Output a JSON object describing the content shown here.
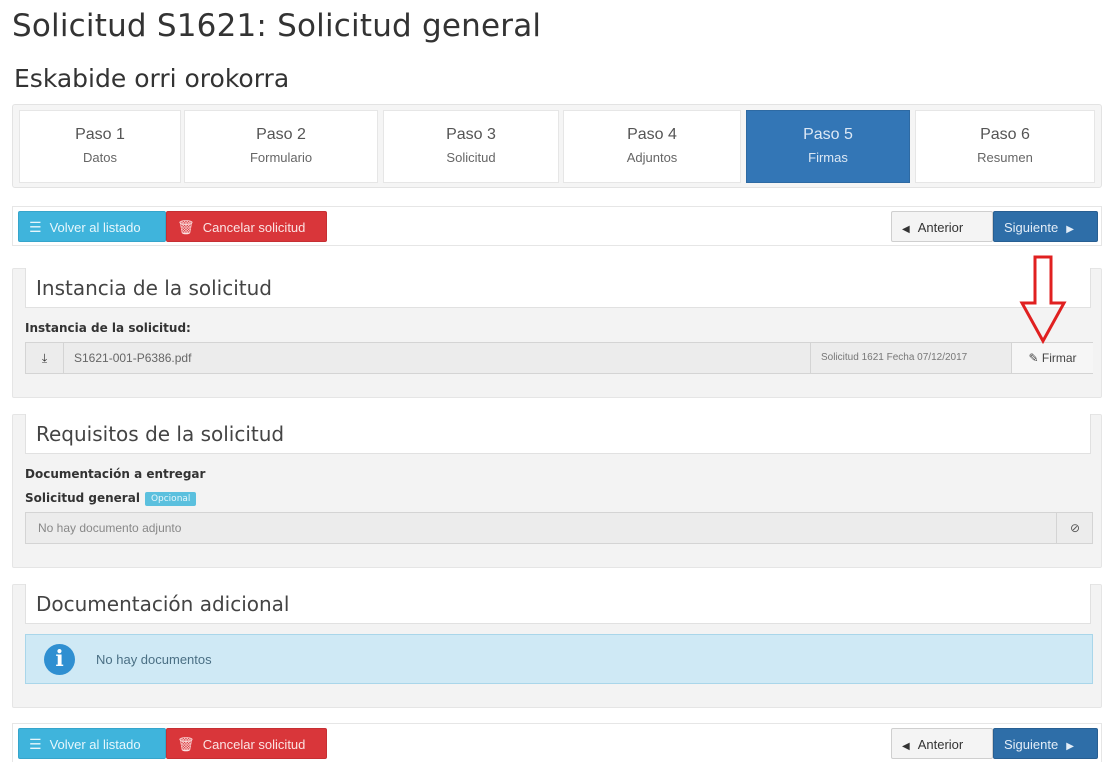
{
  "header": {
    "title": "Solicitud S1621: Solicitud general",
    "subtitle": "Eskabide orri orokorra"
  },
  "steps": [
    {
      "num": "Paso 1",
      "label": "Datos"
    },
    {
      "num": "Paso 2",
      "label": "Formulario"
    },
    {
      "num": "Paso 3",
      "label": "Solicitud"
    },
    {
      "num": "Paso 4",
      "label": "Adjuntos"
    },
    {
      "num": "Paso 5",
      "label": "Firmas"
    },
    {
      "num": "Paso 6",
      "label": "Resumen"
    }
  ],
  "toolbar": {
    "back_label": "Volver al listado",
    "cancel_label": "Cancelar solicitud",
    "prev_label": "Anterior",
    "next_label": "Siguiente"
  },
  "instancia": {
    "heading": "Instancia de la solicitud",
    "field_label": "Instancia de la solicitud:",
    "file_name": "S1621-001-P6386.pdf",
    "file_meta": "Solicitud 1621 Fecha 07/12/2017",
    "sign_label": "Firmar"
  },
  "requisitos": {
    "heading": "Requisitos de la solicitud",
    "doc_label": "Documentación a entregar",
    "item_label": "Solicitud general",
    "item_badge": "Opcional",
    "empty_text": "No hay documento adjunto"
  },
  "adicional": {
    "heading": "Documentación adicional",
    "empty_text": "No hay documentos"
  },
  "colors": {
    "active_step": "#3376b6",
    "info": "#3fb4dc",
    "danger": "#d9363a",
    "primary": "#2e6ea8",
    "arrow": "#e02020"
  },
  "icons": {
    "list": "list-icon",
    "trash": "trash-icon",
    "prev": "caret-left-icon",
    "next": "caret-right-icon",
    "download": "download-icon",
    "sign": "edit-icon",
    "ban": "ban-icon",
    "info": "info-circle-icon",
    "arrow": "arrow-down-icon"
  }
}
